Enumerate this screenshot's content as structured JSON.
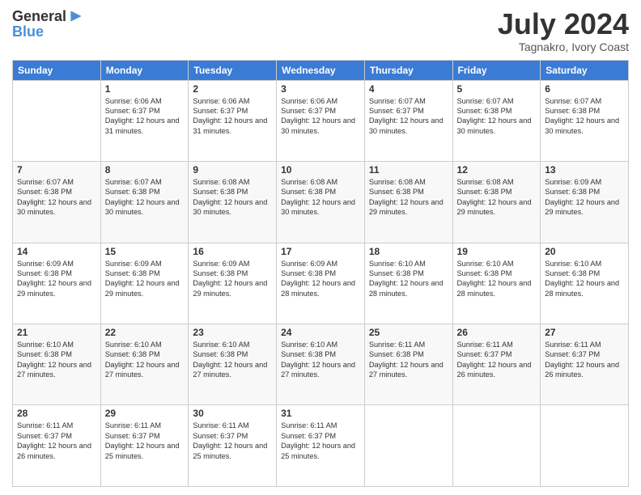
{
  "header": {
    "logo": {
      "text_general": "General",
      "text_blue": "Blue"
    },
    "title": "July 2024",
    "location": "Tagnakro, Ivory Coast"
  },
  "days_of_week": [
    "Sunday",
    "Monday",
    "Tuesday",
    "Wednesday",
    "Thursday",
    "Friday",
    "Saturday"
  ],
  "weeks": [
    [
      {
        "day": "",
        "sunrise": "",
        "sunset": "",
        "daylight": ""
      },
      {
        "day": "1",
        "sunrise": "Sunrise: 6:06 AM",
        "sunset": "Sunset: 6:37 PM",
        "daylight": "Daylight: 12 hours and 31 minutes."
      },
      {
        "day": "2",
        "sunrise": "Sunrise: 6:06 AM",
        "sunset": "Sunset: 6:37 PM",
        "daylight": "Daylight: 12 hours and 31 minutes."
      },
      {
        "day": "3",
        "sunrise": "Sunrise: 6:06 AM",
        "sunset": "Sunset: 6:37 PM",
        "daylight": "Daylight: 12 hours and 30 minutes."
      },
      {
        "day": "4",
        "sunrise": "Sunrise: 6:07 AM",
        "sunset": "Sunset: 6:37 PM",
        "daylight": "Daylight: 12 hours and 30 minutes."
      },
      {
        "day": "5",
        "sunrise": "Sunrise: 6:07 AM",
        "sunset": "Sunset: 6:38 PM",
        "daylight": "Daylight: 12 hours and 30 minutes."
      },
      {
        "day": "6",
        "sunrise": "Sunrise: 6:07 AM",
        "sunset": "Sunset: 6:38 PM",
        "daylight": "Daylight: 12 hours and 30 minutes."
      }
    ],
    [
      {
        "day": "7",
        "sunrise": "Sunrise: 6:07 AM",
        "sunset": "Sunset: 6:38 PM",
        "daylight": "Daylight: 12 hours and 30 minutes."
      },
      {
        "day": "8",
        "sunrise": "Sunrise: 6:07 AM",
        "sunset": "Sunset: 6:38 PM",
        "daylight": "Daylight: 12 hours and 30 minutes."
      },
      {
        "day": "9",
        "sunrise": "Sunrise: 6:08 AM",
        "sunset": "Sunset: 6:38 PM",
        "daylight": "Daylight: 12 hours and 30 minutes."
      },
      {
        "day": "10",
        "sunrise": "Sunrise: 6:08 AM",
        "sunset": "Sunset: 6:38 PM",
        "daylight": "Daylight: 12 hours and 30 minutes."
      },
      {
        "day": "11",
        "sunrise": "Sunrise: 6:08 AM",
        "sunset": "Sunset: 6:38 PM",
        "daylight": "Daylight: 12 hours and 29 minutes."
      },
      {
        "day": "12",
        "sunrise": "Sunrise: 6:08 AM",
        "sunset": "Sunset: 6:38 PM",
        "daylight": "Daylight: 12 hours and 29 minutes."
      },
      {
        "day": "13",
        "sunrise": "Sunrise: 6:09 AM",
        "sunset": "Sunset: 6:38 PM",
        "daylight": "Daylight: 12 hours and 29 minutes."
      }
    ],
    [
      {
        "day": "14",
        "sunrise": "Sunrise: 6:09 AM",
        "sunset": "Sunset: 6:38 PM",
        "daylight": "Daylight: 12 hours and 29 minutes."
      },
      {
        "day": "15",
        "sunrise": "Sunrise: 6:09 AM",
        "sunset": "Sunset: 6:38 PM",
        "daylight": "Daylight: 12 hours and 29 minutes."
      },
      {
        "day": "16",
        "sunrise": "Sunrise: 6:09 AM",
        "sunset": "Sunset: 6:38 PM",
        "daylight": "Daylight: 12 hours and 29 minutes."
      },
      {
        "day": "17",
        "sunrise": "Sunrise: 6:09 AM",
        "sunset": "Sunset: 6:38 PM",
        "daylight": "Daylight: 12 hours and 28 minutes."
      },
      {
        "day": "18",
        "sunrise": "Sunrise: 6:10 AM",
        "sunset": "Sunset: 6:38 PM",
        "daylight": "Daylight: 12 hours and 28 minutes."
      },
      {
        "day": "19",
        "sunrise": "Sunrise: 6:10 AM",
        "sunset": "Sunset: 6:38 PM",
        "daylight": "Daylight: 12 hours and 28 minutes."
      },
      {
        "day": "20",
        "sunrise": "Sunrise: 6:10 AM",
        "sunset": "Sunset: 6:38 PM",
        "daylight": "Daylight: 12 hours and 28 minutes."
      }
    ],
    [
      {
        "day": "21",
        "sunrise": "Sunrise: 6:10 AM",
        "sunset": "Sunset: 6:38 PM",
        "daylight": "Daylight: 12 hours and 27 minutes."
      },
      {
        "day": "22",
        "sunrise": "Sunrise: 6:10 AM",
        "sunset": "Sunset: 6:38 PM",
        "daylight": "Daylight: 12 hours and 27 minutes."
      },
      {
        "day": "23",
        "sunrise": "Sunrise: 6:10 AM",
        "sunset": "Sunset: 6:38 PM",
        "daylight": "Daylight: 12 hours and 27 minutes."
      },
      {
        "day": "24",
        "sunrise": "Sunrise: 6:10 AM",
        "sunset": "Sunset: 6:38 PM",
        "daylight": "Daylight: 12 hours and 27 minutes."
      },
      {
        "day": "25",
        "sunrise": "Sunrise: 6:11 AM",
        "sunset": "Sunset: 6:38 PM",
        "daylight": "Daylight: 12 hours and 27 minutes."
      },
      {
        "day": "26",
        "sunrise": "Sunrise: 6:11 AM",
        "sunset": "Sunset: 6:37 PM",
        "daylight": "Daylight: 12 hours and 26 minutes."
      },
      {
        "day": "27",
        "sunrise": "Sunrise: 6:11 AM",
        "sunset": "Sunset: 6:37 PM",
        "daylight": "Daylight: 12 hours and 26 minutes."
      }
    ],
    [
      {
        "day": "28",
        "sunrise": "Sunrise: 6:11 AM",
        "sunset": "Sunset: 6:37 PM",
        "daylight": "Daylight: 12 hours and 26 minutes."
      },
      {
        "day": "29",
        "sunrise": "Sunrise: 6:11 AM",
        "sunset": "Sunset: 6:37 PM",
        "daylight": "Daylight: 12 hours and 25 minutes."
      },
      {
        "day": "30",
        "sunrise": "Sunrise: 6:11 AM",
        "sunset": "Sunset: 6:37 PM",
        "daylight": "Daylight: 12 hours and 25 minutes."
      },
      {
        "day": "31",
        "sunrise": "Sunrise: 6:11 AM",
        "sunset": "Sunset: 6:37 PM",
        "daylight": "Daylight: 12 hours and 25 minutes."
      },
      {
        "day": "",
        "sunrise": "",
        "sunset": "",
        "daylight": ""
      },
      {
        "day": "",
        "sunrise": "",
        "sunset": "",
        "daylight": ""
      },
      {
        "day": "",
        "sunrise": "",
        "sunset": "",
        "daylight": ""
      }
    ]
  ]
}
